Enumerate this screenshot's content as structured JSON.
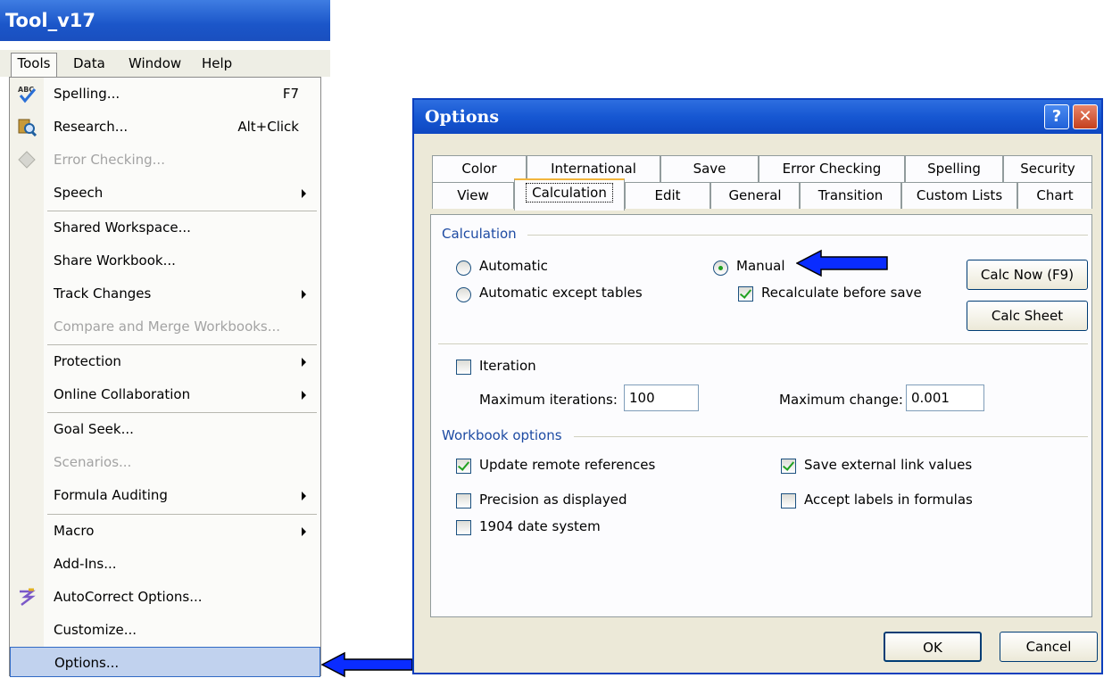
{
  "excel": {
    "title": "Tool_v17",
    "menubar": [
      {
        "label": "Tools"
      },
      {
        "label": "Data"
      },
      {
        "label": "Window"
      },
      {
        "label": "Help"
      }
    ],
    "tools_menu": [
      {
        "label": "Spelling...",
        "shortcut": "F7",
        "icon": "spelling-icon"
      },
      {
        "label": "Research...",
        "shortcut": "Alt+Click",
        "icon": "research-icon"
      },
      {
        "label": "Error Checking...",
        "icon": "error-checking-icon",
        "disabled": true
      },
      {
        "label": "Speech",
        "submenu": true
      },
      {
        "label": "Shared Workspace..."
      },
      {
        "label": "Share Workbook..."
      },
      {
        "label": "Track Changes",
        "submenu": true
      },
      {
        "label": "Compare and Merge Workbooks...",
        "disabled": true
      },
      {
        "label": "Protection",
        "submenu": true
      },
      {
        "label": "Online Collaboration",
        "submenu": true
      },
      {
        "label": "Goal Seek..."
      },
      {
        "label": "Scenarios...",
        "disabled": true
      },
      {
        "label": "Formula Auditing",
        "submenu": true
      },
      {
        "label": "Macro",
        "submenu": true
      },
      {
        "label": "Add-Ins..."
      },
      {
        "label": "AutoCorrect Options...",
        "icon": "autocorrect-icon"
      },
      {
        "label": "Customize..."
      },
      {
        "label": "Options...",
        "highlighted": true
      }
    ]
  },
  "dialog": {
    "title": "Options",
    "help_label": "?",
    "close_label": "✕",
    "tabs_row1": [
      "Color",
      "International",
      "Save",
      "Error Checking",
      "Spelling",
      "Security"
    ],
    "tabs_row2": [
      "View",
      "Calculation",
      "Edit",
      "General",
      "Transition",
      "Custom Lists",
      "Chart"
    ],
    "active_tab": "Calculation",
    "calculation": {
      "group_label": "Calculation",
      "automatic": "Automatic",
      "automatic_except_tables": "Automatic except tables",
      "manual": "Manual",
      "selected": "Manual",
      "recalculate_before_save": "Recalculate before save",
      "recalculate_checked": true,
      "calc_now": "Calc Now (F9)",
      "calc_sheet": "Calc Sheet",
      "iteration": "Iteration",
      "iteration_checked": false,
      "max_iterations_label": "Maximum iterations:",
      "max_iterations_value": "100",
      "max_change_label": "Maximum change:",
      "max_change_value": "0.001"
    },
    "workbook": {
      "group_label": "Workbook options",
      "update_remote_references": "Update remote references",
      "update_remote_checked": true,
      "precision_as_displayed": "Precision as displayed",
      "precision_checked": false,
      "date_1904": "1904 date system",
      "date_1904_checked": false,
      "save_external_link_values": "Save external link values",
      "save_external_checked": true,
      "accept_labels_in_formulas": "Accept labels in formulas",
      "accept_labels_checked": false
    },
    "ok": "OK",
    "cancel": "Cancel"
  },
  "colors": {
    "xp_title_blue": "#1b56c9",
    "menu_highlight": "#c1d2ee",
    "arrow_blue": "#0a2cff",
    "group_label_blue": "#1e4ba3"
  }
}
